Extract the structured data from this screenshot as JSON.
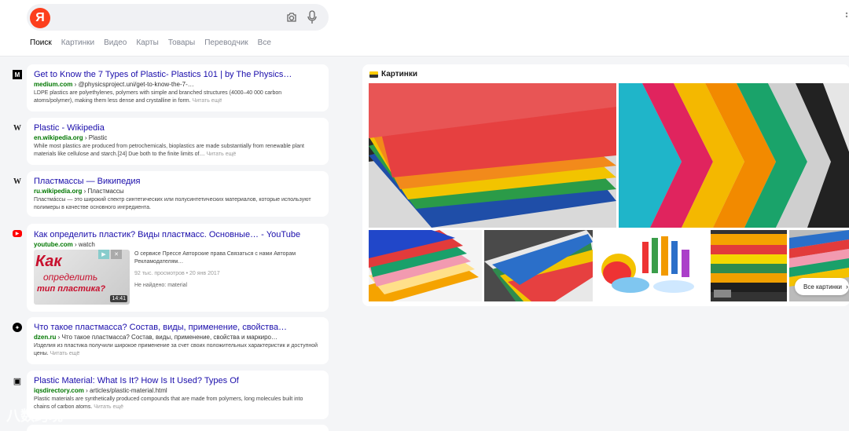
{
  "header": {
    "logo_letter": "Я",
    "search_value": "",
    "tabs": [
      "Поиск",
      "Картинки",
      "Видео",
      "Карты",
      "Товары",
      "Переводчик",
      "Все"
    ]
  },
  "results": [
    {
      "title": "Get to Know the 7 Types of Plastic- Plastics 101 | by The Physics…",
      "domain": "medium.com",
      "path": "@physicsproject.uni/get-to-know-the-7-…",
      "snippet": "LDPE plastics are polyethylenes, polymers with simple and branched structures (4000–40 000 carbon atoms/polymer), making them less dense and crystalline in form.",
      "more": "Читать ещё",
      "favicon": "M"
    },
    {
      "title": "Plastic - Wikipedia",
      "domain": "en.wikipedia.org",
      "path": "Plastic",
      "snippet": "While most plastics are produced from petrochemicals, bioplastics are made substantially from renewable plant materials like cellulose and starch.[24] Due both to the finite limits of…",
      "more": "Читать ещё",
      "favicon": "W"
    },
    {
      "title": "Пластмассы — Википедия",
      "domain": "ru.wikipedia.org",
      "path": "Пластмассы",
      "snippet": "Пластма́ссы — это широкий спектр синтетических или полусинтетических материалов, которые используют полимеры в качестве основного ингредиента.",
      "more": "",
      "favicon": "W"
    },
    {
      "title": "Как определить пластик? Виды пластмасс. Основные… - YouTube",
      "domain": "youtube.com",
      "path": "watch",
      "video_desc": "О сервисе Прессе Авторские права Связаться с нами Авторам Рекламодателям…",
      "video_meta": "92 тыс. просмотров • 20 янв 2017",
      "not_found": "Не найдено: material",
      "thumb_text_1": "Как",
      "thumb_text_2": "определить",
      "thumb_text_3": "тип пластика?",
      "duration": "14:41",
      "favicon": "▶"
    },
    {
      "title": "Что такое пластмасса? Состав, виды, применение, свойства…",
      "domain": "dzen.ru",
      "path": "Что такое пластмасса? Состав, виды, применение, свойства и маркиро…",
      "snippet": "Изделия из пластика получили широкое применение за счет своих положительных характеристик и доступной цены.",
      "more": "Читать ещё",
      "favicon": "✦"
    },
    {
      "title": "Plastic Material: What Is It? How Is It Used? Types Of",
      "domain": "iqsdirectory.com",
      "path": "articles/plastic-material.html",
      "snippet": "Plastic materials are synthetically produced compounds that are made from polymers, long molecules built into chains of carbon atoms.",
      "more": "Читать ещё",
      "favicon": "▣"
    }
  ],
  "images": {
    "heading": "Картинки",
    "all_button": "Все картинки"
  },
  "watermark": "八数跨境"
}
